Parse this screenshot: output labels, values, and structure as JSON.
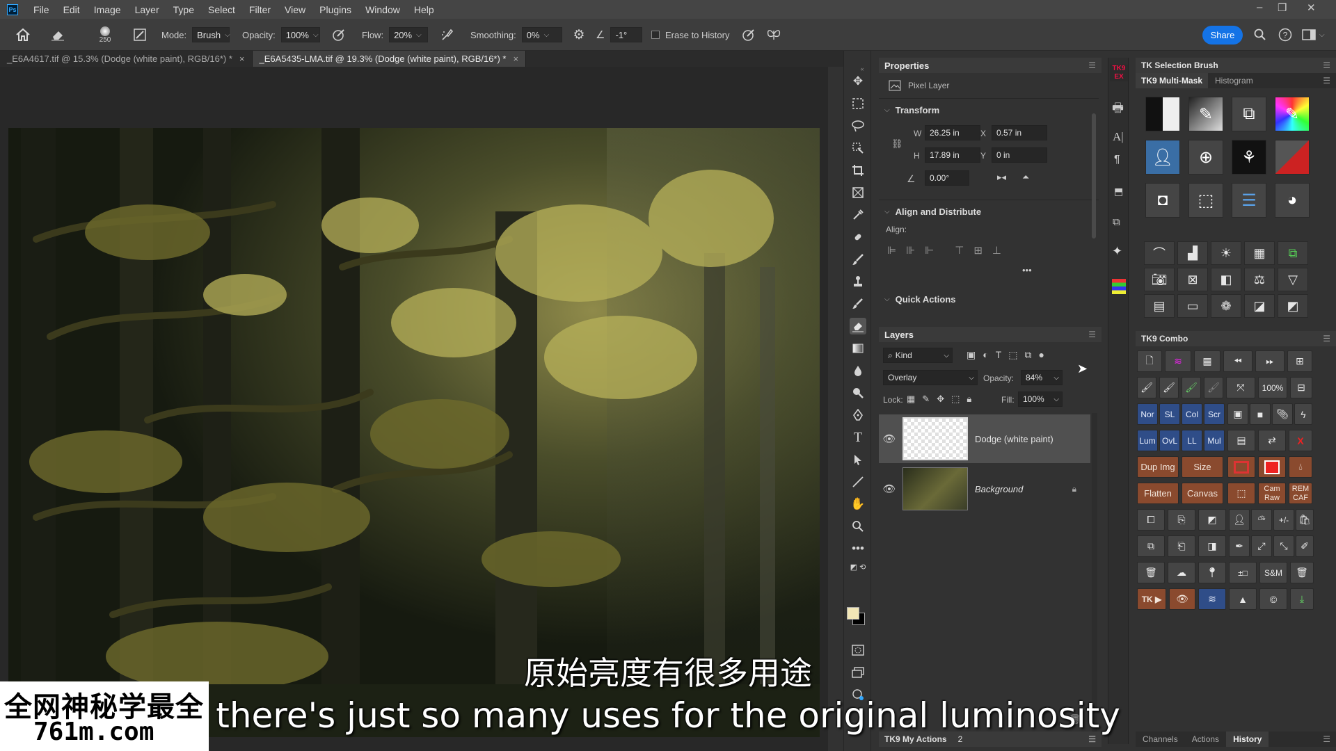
{
  "app": {
    "logo": "Ps"
  },
  "menu": [
    "File",
    "Edit",
    "Image",
    "Layer",
    "Type",
    "Select",
    "Filter",
    "View",
    "Plugins",
    "Window",
    "Help"
  ],
  "window_controls": [
    "–",
    "❐",
    "✕"
  ],
  "options": {
    "brush_size": "250",
    "mode_label": "Mode:",
    "mode_value": "Brush",
    "opacity_label": "Opacity:",
    "opacity_value": "100%",
    "flow_label": "Flow:",
    "flow_value": "20%",
    "smoothing_label": "Smoothing:",
    "smoothing_value": "0%",
    "angle_value": "-1°",
    "erase_history_label": "Erase to History",
    "share_label": "Share"
  },
  "tabs": [
    {
      "label": "_E6A4617.tif @ 15.3% (Dodge (white paint), RGB/16*) *",
      "active": false
    },
    {
      "label": "_E6A5435-LMA.tif @ 19.3% (Dodge (white paint), RGB/16*) *",
      "active": true
    }
  ],
  "properties": {
    "title": "Properties",
    "layer_type": "Pixel Layer",
    "transform_title": "Transform",
    "w_label": "W",
    "w_value": "26.25 in",
    "h_label": "H",
    "h_value": "17.89 in",
    "x_label": "X",
    "x_value": "0.57 in",
    "y_label": "Y",
    "y_value": "0 in",
    "angle_value": "0.00°",
    "align_title": "Align and Distribute",
    "align_label": "Align:",
    "quick_actions_title": "Quick Actions"
  },
  "layers": {
    "title": "Layers",
    "kind_label": "Kind",
    "blend_mode": "Overlay",
    "opacity_label": "Opacity:",
    "opacity_value": "84%",
    "lock_label": "Lock:",
    "fill_label": "Fill:",
    "fill_value": "100%",
    "items": [
      {
        "name": "Dodge (white paint)",
        "selected": true
      },
      {
        "name": "Background",
        "selected": false,
        "locked": true
      }
    ]
  },
  "tk_my_actions": {
    "label": "TK9 My Actions",
    "count": "2"
  },
  "tk_selection": {
    "title": "TK Selection Brush"
  },
  "tk_multimask": {
    "tab_active": "TK9 Multi-Mask",
    "tab_other": "Histogram"
  },
  "tk_combo": {
    "title": "TK9 Combo",
    "buttons": {
      "zoom100": "100%",
      "nor": "Nor",
      "sl": "SL",
      "col": "Col",
      "scr": "Scr",
      "lum": "Lum",
      "ovl": "OvL",
      "ll": "LL",
      "mul": "Mul",
      "dup_img": "Dup Img",
      "size": "Size",
      "flatten": "Flatten",
      "canvas": "Canvas",
      "cam_raw_1": "Cam",
      "cam_raw_2": "Raw",
      "rem_caf_1": "REM",
      "rem_caf_2": "CAF",
      "pm": "+/-",
      "sm": "S&M",
      "plusminus": "±□",
      "tk": "TK ▶"
    }
  },
  "bottom_tabs": [
    "Channels",
    "Actions",
    "History"
  ],
  "bottom_tab_active": "History",
  "subtitles": {
    "cn": "原始亮度有很多用途",
    "en": "there's just so many uses for the original luminosity"
  },
  "watermark": {
    "line1": "全网神秘学最全",
    "line2": "761m.com"
  },
  "colors": {
    "accent": "#1473e6",
    "foreground_swatch": "#f2e6b6",
    "background_swatch": "#000000"
  }
}
